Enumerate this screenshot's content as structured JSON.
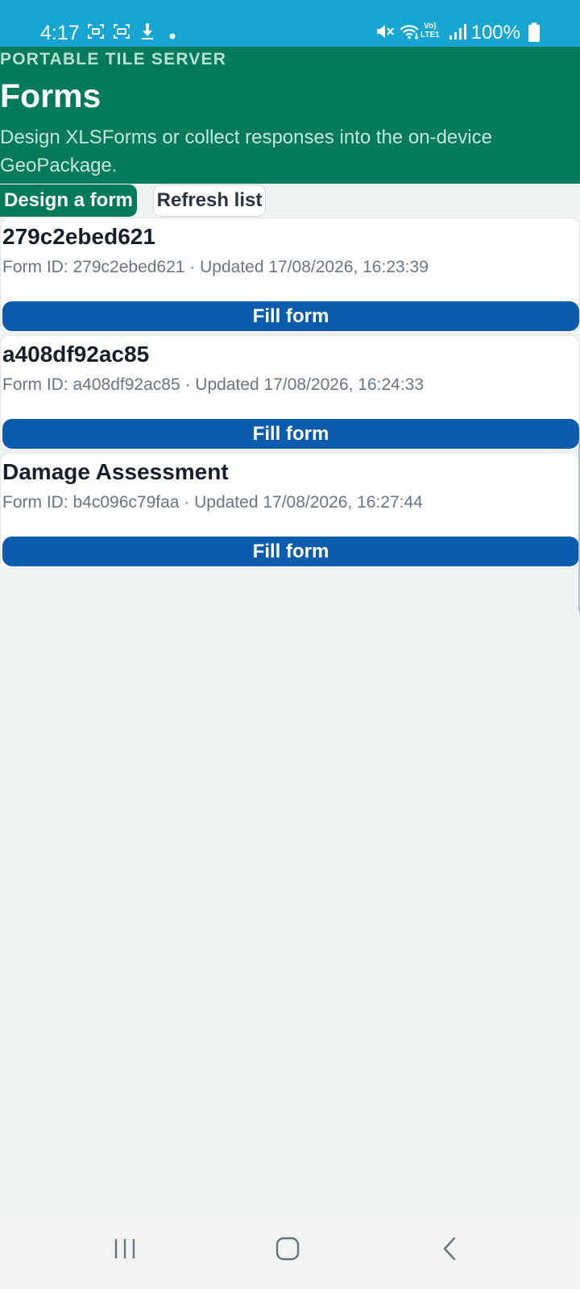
{
  "status_bar": {
    "time": "4:17",
    "battery": "100%",
    "icons": [
      "screenshot-icon",
      "screen-record-icon",
      "download-icon",
      "dot-icon",
      "mute-icon",
      "wifi-icon",
      "volte-icon",
      "signal-icon",
      "battery-icon"
    ],
    "volte_line1": "Vo)",
    "volte_line2": "LTE1"
  },
  "header": {
    "eyebrow": "PORTABLE TILE SERVER",
    "title": "Forms",
    "subtitle": "Design XLSForms or collect responses into the on-device GeoPackage."
  },
  "toolbar": {
    "design_label": "Design a form",
    "refresh_label": "Refresh list"
  },
  "forms": [
    {
      "title": "279c2ebed621",
      "meta": "Form ID: 279c2ebed621 · Updated 17/08/2026, 16:23:39",
      "button": "Fill form"
    },
    {
      "title": "a408df92ac85",
      "meta": "Form ID: a408df92ac85 · Updated 17/08/2026, 16:24:33",
      "button": "Fill form"
    },
    {
      "title": "Damage Assessment",
      "meta": "Form ID: b4c096c79faa · Updated 17/08/2026, 16:27:44",
      "button": "Fill form"
    }
  ],
  "nav_bar": {
    "icons": [
      "recent-apps-icon",
      "home-icon",
      "back-icon"
    ]
  },
  "colors": {
    "status_bar": "#17a5d2",
    "header": "#027a5b",
    "fill_button": "#0b5cad",
    "background": "#f0f3f4"
  }
}
